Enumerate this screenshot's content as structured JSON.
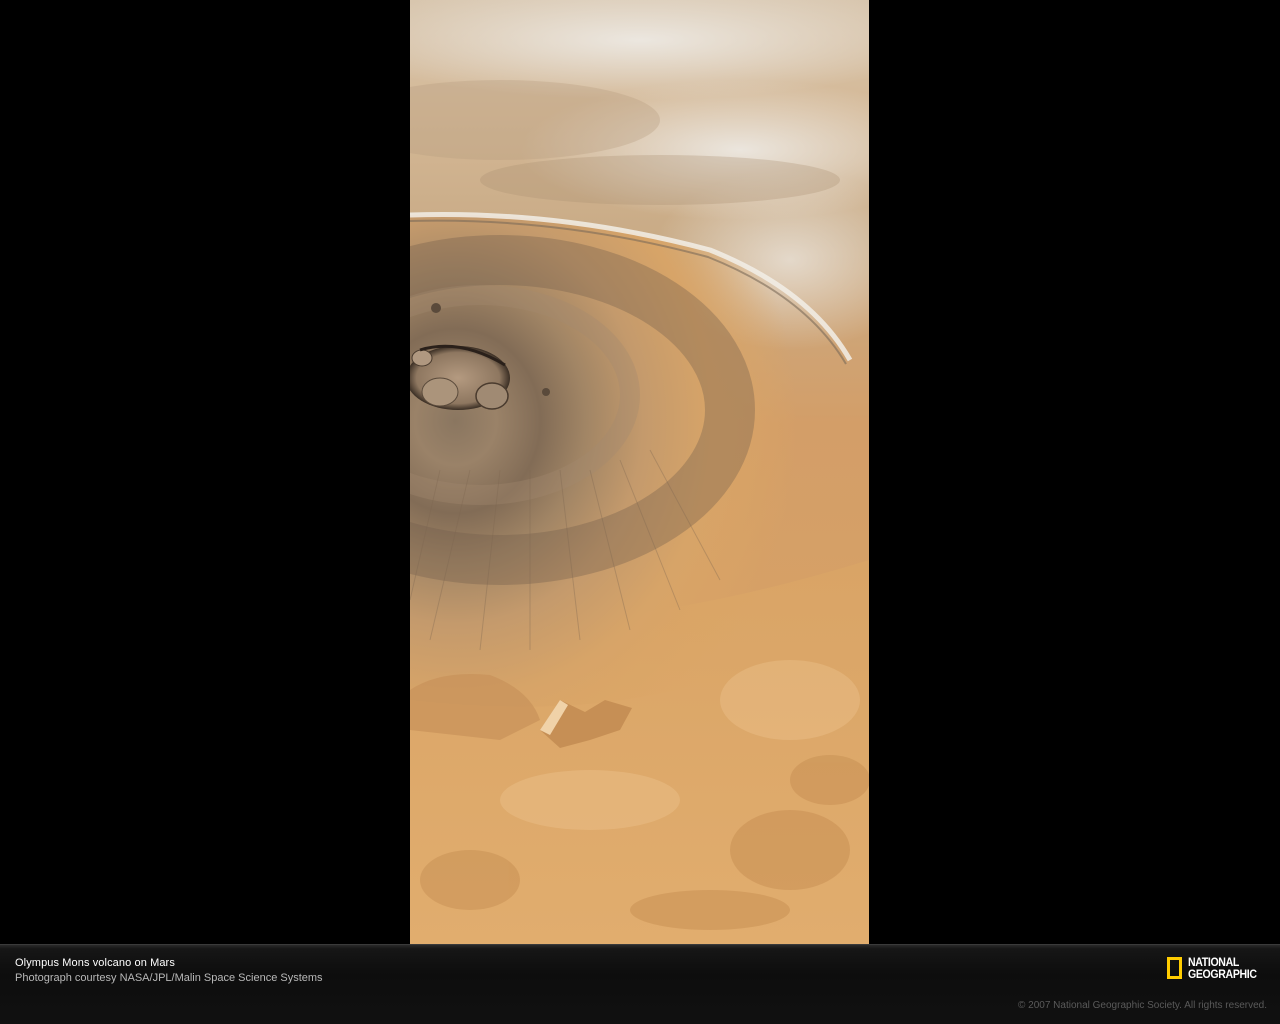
{
  "caption": {
    "title": "Olympus Mons volcano on Mars",
    "credit": "Photograph courtesy NASA/JPL/Malin Space Science Systems"
  },
  "logo": {
    "line1": "NATIONAL",
    "line2": "GEOGRAPHIC",
    "border_color": "#ffcc00"
  },
  "copyright": "© 2007 National Geographic Society. All rights reserved.",
  "colors": {
    "background": "#000000",
    "terrain": "#d9a568",
    "clouds": "#e6e2dc"
  }
}
